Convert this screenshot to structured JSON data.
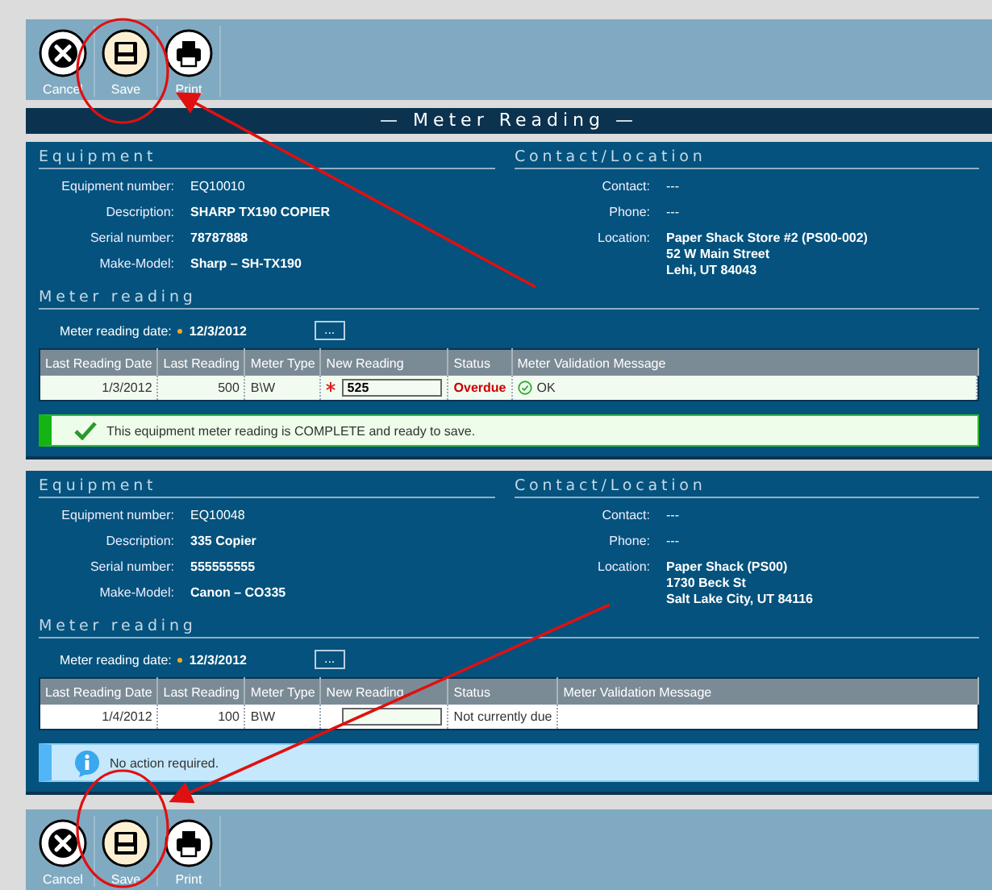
{
  "top_toolbar": {
    "buttons": [
      {
        "kind": "cancel",
        "label": "Cancel",
        "highlighted": false
      },
      {
        "kind": "save",
        "label": "Save",
        "highlighted": true
      },
      {
        "kind": "print",
        "label": "Print",
        "highlighted": false
      }
    ]
  },
  "title": "— Meter Reading —",
  "records": [
    {
      "equipment_heading": "Equipment",
      "contact_heading": "Contact/Location",
      "equipment_fields": [
        {
          "label": "Equipment number:",
          "value": "EQ10010",
          "bold": false
        },
        {
          "label": "Description:",
          "value": "SHARP TX190 COPIER",
          "bold": true
        },
        {
          "label": "Serial number:",
          "value": "78787888",
          "bold": true
        },
        {
          "label": "Make-Model:",
          "value": "Sharp – SH-TX190",
          "bold": true
        }
      ],
      "contact_fields": [
        {
          "label": "Contact:",
          "lines": [
            "---"
          ],
          "bold": false
        },
        {
          "label": "Phone:",
          "lines": [
            "---"
          ],
          "bold": false
        },
        {
          "label": "Location:",
          "lines": [
            "Paper Shack Store #2 (PS00-002)",
            "52 W Main Street",
            "Lehi, UT 84043"
          ],
          "bold": true
        }
      ],
      "meter_heading": "Meter reading",
      "date_label": "Meter reading date:",
      "date_required": true,
      "date": "12/3/2012",
      "date_button": "...",
      "columns": [
        "Last Reading Date",
        "Last Reading",
        "Meter Type",
        "New Reading",
        "Status",
        "Meter Validation Message"
      ],
      "row": {
        "last_date": "1/3/2012",
        "last_reading": "500",
        "meter_type": "B\\W",
        "new_required": true,
        "new_reading": "525",
        "status": "Overdue",
        "overdue": true,
        "validation": "OK"
      },
      "message": {
        "kind": "success",
        "text": "This equipment meter reading is COMPLETE and ready to save."
      }
    },
    {
      "equipment_heading": "Equipment",
      "contact_heading": "Contact/Location",
      "equipment_fields": [
        {
          "label": "Equipment number:",
          "value": "EQ10048",
          "bold": false
        },
        {
          "label": "Description:",
          "value": "335 Copier",
          "bold": true
        },
        {
          "label": "Serial number:",
          "value": "555555555",
          "bold": true
        },
        {
          "label": "Make-Model:",
          "value": "Canon – CO335",
          "bold": true
        }
      ],
      "contact_fields": [
        {
          "label": "Contact:",
          "lines": [
            "---"
          ],
          "bold": false
        },
        {
          "label": "Phone:",
          "lines": [
            "---"
          ],
          "bold": false
        },
        {
          "label": "Location:",
          "lines": [
            "Paper Shack (PS00)",
            "1730 Beck St",
            "Salt Lake City, UT 84116"
          ],
          "bold": true
        }
      ],
      "meter_heading": "Meter reading",
      "date_label": "Meter reading date:",
      "date_required": true,
      "date": "12/3/2012",
      "date_button": "...",
      "columns": [
        "Last Reading Date",
        "Last Reading",
        "Meter Type",
        "New Reading",
        "Status",
        "Meter Validation Message"
      ],
      "row": {
        "last_date": "1/4/2012",
        "last_reading": "100",
        "meter_type": "B\\W",
        "new_required": false,
        "status": "Not currently due",
        "overdue": false
      },
      "message": {
        "kind": "info",
        "text": "No action required."
      }
    }
  ],
  "bottom_toolbar": {
    "buttons": [
      {
        "kind": "cancel",
        "label": "Cancel",
        "highlighted": false
      },
      {
        "kind": "save",
        "label": "Save",
        "highlighted": true
      },
      {
        "kind": "print",
        "label": "Print",
        "highlighted": false
      }
    ]
  }
}
